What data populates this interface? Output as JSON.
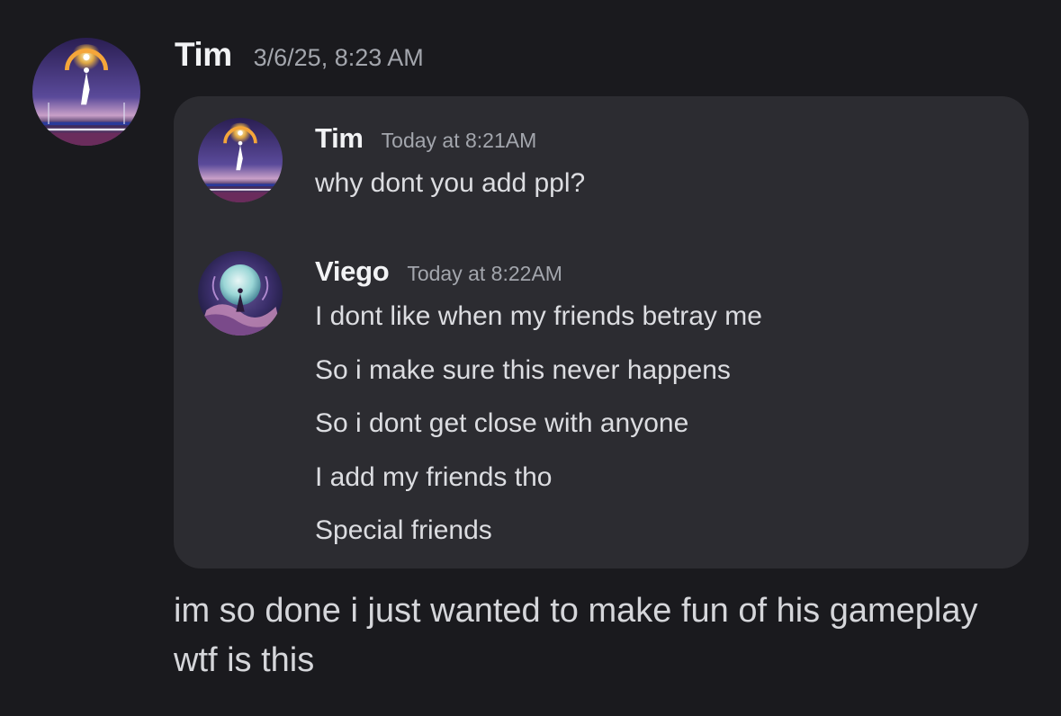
{
  "message": {
    "author": "Tim",
    "timestamp": "3/6/25, 8:23 AM",
    "avatar_icon": "night-sky-figure-avatar",
    "text": "im so done i just wanted to make fun of his gameplay wtf is this"
  },
  "forwarded": [
    {
      "author": "Tim",
      "timestamp": "Today at 8:21AM",
      "avatar_icon": "night-sky-figure-avatar",
      "lines": [
        "why dont you add ppl?"
      ]
    },
    {
      "author": "Viego",
      "timestamp": "Today at 8:22AM",
      "avatar_icon": "moon-figure-avatar",
      "lines": [
        "I dont like when my friends betray me",
        "So i make sure this never happens",
        "So i dont get close with anyone",
        "I add my friends tho",
        "Special friends"
      ]
    }
  ],
  "colors": {
    "background": "#1a1a1e",
    "card": "#2c2c31",
    "username": "#f2f3f5",
    "timestamp": "#a3a6ad",
    "text": "#d5d6da"
  }
}
